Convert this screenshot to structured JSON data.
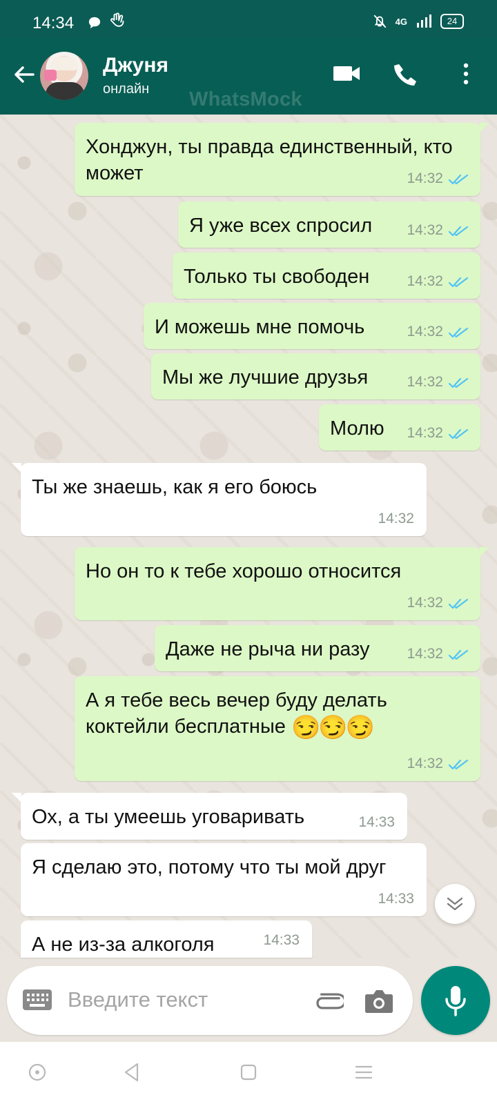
{
  "status_bar": {
    "time": "14:34",
    "signal": "4G",
    "battery": "24"
  },
  "chat_header": {
    "name": "Джуня",
    "status": "онлайн",
    "watermark": "WhatsMock"
  },
  "messages": [
    {
      "direction": "out",
      "text": "Хонджун, ты правда единственный, кто может",
      "time": "14:32",
      "status": "read"
    },
    {
      "direction": "out",
      "text": "Я уже всех спросил",
      "time": "14:32",
      "status": "read"
    },
    {
      "direction": "out",
      "text": "Только ты свободен",
      "time": "14:32",
      "status": "read"
    },
    {
      "direction": "out",
      "text": "И можешь мне помочь",
      "time": "14:32",
      "status": "read"
    },
    {
      "direction": "out",
      "text": "Мы же лучшие друзья",
      "time": "14:32",
      "status": "read"
    },
    {
      "direction": "out",
      "text": "Молю",
      "time": "14:32",
      "status": "read"
    },
    {
      "direction": "in",
      "text": "Ты же знаешь, как я его боюсь",
      "time": "14:32"
    },
    {
      "direction": "out",
      "text": "Но он то к тебе хорошо относится",
      "time": "14:32",
      "status": "read"
    },
    {
      "direction": "out",
      "text": "Даже не рыча ни разу",
      "time": "14:32",
      "status": "read"
    },
    {
      "direction": "out",
      "text": "А я тебе весь вечер буду делать коктейли бесплатные",
      "emoji": "😏😏😏",
      "time": "14:32",
      "status": "read"
    },
    {
      "direction": "in",
      "text": "Ох, а ты умеешь уговаривать",
      "time": "14:33"
    },
    {
      "direction": "in",
      "text": "Я сделаю это, потому что ты мой друг",
      "time": "14:33"
    },
    {
      "direction": "in",
      "text": "А не из-за алкоголя",
      "time": "14:33"
    }
  ],
  "composer": {
    "placeholder": "Введите текст"
  },
  "icons": {
    "back": "arrow-left-icon",
    "video": "video-call-icon",
    "phone": "phone-icon",
    "menu": "more-vert-icon",
    "scroll": "chevron-down-icon",
    "keyboard": "keyboard-icon",
    "attach": "paperclip-icon",
    "camera": "camera-icon",
    "mic": "microphone-icon"
  },
  "colors": {
    "header": "#075e54",
    "outgoing_bubble": "#dcf8c6",
    "incoming_bubble": "#ffffff",
    "read_ticks": "#4fc3f7",
    "mic_button": "#00897b"
  }
}
